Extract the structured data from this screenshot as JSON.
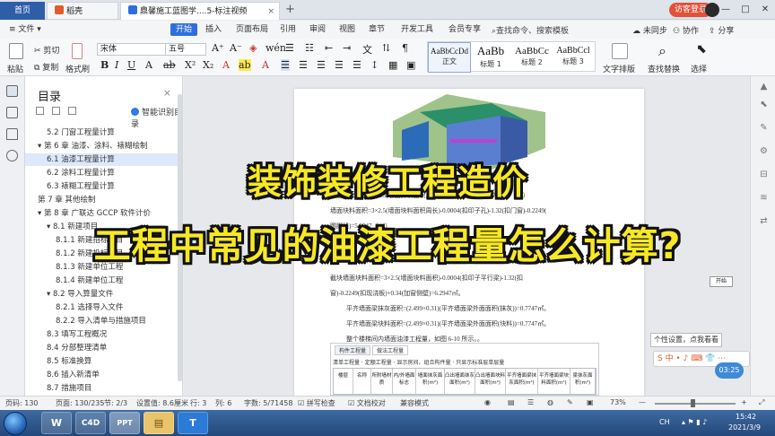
{
  "tabs": {
    "home": "首页",
    "wps": "稻壳",
    "doc": "鼎馨施工蓝图学....5-标注视频",
    "doc_close": "×",
    "new_tab": "+"
  },
  "account": {
    "visitor": "访客登录"
  },
  "window_buttons": {
    "restore": "▭",
    "minimize": "—",
    "maximize": "□",
    "close": "✕"
  },
  "menu": {
    "file": "文件",
    "items": [
      "开始",
      "插入",
      "页面布局",
      "引用",
      "审阅",
      "视图",
      "章节",
      "开发工具",
      "会员专享"
    ],
    "search": "查找命令、搜索模板",
    "right": [
      "未同步",
      "协作",
      "分享"
    ]
  },
  "ribbon": {
    "paste": "粘贴",
    "cut": "剪切",
    "copy": "复制",
    "format_painter": "格式刷",
    "font_name": "宋体",
    "font_size": "五号",
    "styles": [
      {
        "sample": "AaBbCcDd",
        "label": "正文"
      },
      {
        "sample": "AaBb",
        "label": "标题 1"
      },
      {
        "sample": "AaBbCc",
        "label": "标题 2"
      },
      {
        "sample": "AaBbCcl",
        "label": "标题 3"
      }
    ],
    "text_layout": "文字排版",
    "find_replace": "查找替换",
    "select": "选择"
  },
  "toc": {
    "title": "目录",
    "close": "×",
    "smart": "智能识别目录",
    "items": [
      {
        "text": "5.2   门窗工程量计算",
        "indent": 2,
        "selected": false
      },
      {
        "text": "▾ 第 6 章   油漆、涂料、裱糊绘制",
        "indent": 1,
        "selected": false
      },
      {
        "text": "6.1   油漆工程量计算",
        "indent": 2,
        "selected": true
      },
      {
        "text": "6.2   涂料工程量计算",
        "indent": 2,
        "selected": false
      },
      {
        "text": "6.3   裱糊工程量计算",
        "indent": 2,
        "selected": false
      },
      {
        "text": "第 7 章   其他绘制",
        "indent": 1,
        "selected": false
      },
      {
        "text": "▾ 第 8 章   广联达 GCCP 软件计价",
        "indent": 1,
        "selected": false
      },
      {
        "text": "▾ 8.1   新建项目",
        "indent": 2,
        "selected": false
      },
      {
        "text": "8.1.1   新建招标项目",
        "indent": 3,
        "selected": false
      },
      {
        "text": "8.1.2   新建投标项目",
        "indent": 3,
        "selected": false
      },
      {
        "text": "8.1.3   新建单位工程",
        "indent": 3,
        "selected": false
      },
      {
        "text": "8.1.4 新建单位工程",
        "indent": 3,
        "selected": false
      },
      {
        "text": "▾ 8.2   导入算量文件",
        "indent": 2,
        "selected": false
      },
      {
        "text": "8.2.1   选择导入文件",
        "indent": 3,
        "selected": false
      },
      {
        "text": "8.2.2   导入清单与措施项目",
        "indent": 3,
        "selected": false
      },
      {
        "text": "8.3   填写工程概况",
        "indent": 2,
        "selected": false
      },
      {
        "text": "8.4   分部整理清单",
        "indent": 2,
        "selected": false
      },
      {
        "text": "8.5   标准换算",
        "indent": 2,
        "selected": false
      },
      {
        "text": "8.6   插入新清单",
        "indent": 2,
        "selected": false
      },
      {
        "text": "8.7   措施项目",
        "indent": 2,
        "selected": false
      }
    ]
  },
  "doc": {
    "lines": [
      "墙面抹灰面积=3×2.5(墙面抹灰面积周长)-0.0004(扣印子孔)=7.4996（m²）",
      "墙面块料面积=3×2.5(墙面块料面积周长)-0.0004(扣印子孔)-1.32(扣门窗)-0.2249(",
      "踢脚线)=5.9547（m²）",
      "截块墙面块料面积=3×2.5(墙面块料面积)-0.0004(扣印子平行梁)-1.32(扣",
      "窗)-0.2249(扣现浇板)+0.34(加窗侧壁)=6.2947㎡。",
      "平齐墙面梁抹灰面积=(2.499×0.31)(平齐墙面梁外面面积(抹灰))=0.7747㎡。",
      "平齐墙面梁块料面积=(2.499×0.31)(平齐墙面梁外面面积(块料))=0.7747㎡。",
      "整个楼梯间内墙面油漆工程量，如图 6-10 所示。。"
    ],
    "shot": {
      "tabs": [
        "构件工程量",
        "做法工程量"
      ],
      "options": [
        "清单工程量",
        "定额工程量",
        "显示房间、组合构件量",
        "只显示标准层单层量"
      ],
      "headers": [
        "楼层",
        "名称",
        "所附墙材质",
        "内/外墙面标志",
        "墙面抹灰面积(m²)",
        "凸出墙面抹灰面积(m²)",
        "凸出墙面块料面积(m²)",
        "平齐墙面梁抹灰面积(m²)",
        "平齐墙面梁块料面积(m²)",
        "梁抹灰面积(m²)"
      ]
    }
  },
  "popup": "个性设置，点我看看",
  "add_button": "开始",
  "ime": "S 中 • ♪ ⌨ 👕 ⋯",
  "timer": "03:25",
  "overlay": {
    "line1": "装饰装修工程造价",
    "line2": "工程中常见的油漆工程量怎么计算?"
  },
  "status": {
    "page": "页码: 130",
    "pages": "页面: 130/235",
    "section": "节: 2/3",
    "position": "设置值: 8.6厘米",
    "row": "行: 3",
    "col": "列: 6",
    "words": "字数: 5/71458",
    "spell": "拼写检查",
    "proof": "文档校对",
    "compat": "兼容模式",
    "zoom": "73%"
  },
  "taskbar": {
    "apps": [
      "W",
      "C4D",
      "PPT",
      "▤",
      "T"
    ],
    "tray_ime": "CH",
    "time": "15:42",
    "date": "2021/3/9"
  },
  "colors": {
    "accent": "#2f6ee0",
    "overlay_text": "#f7e825",
    "visitor": "#e2513b"
  }
}
